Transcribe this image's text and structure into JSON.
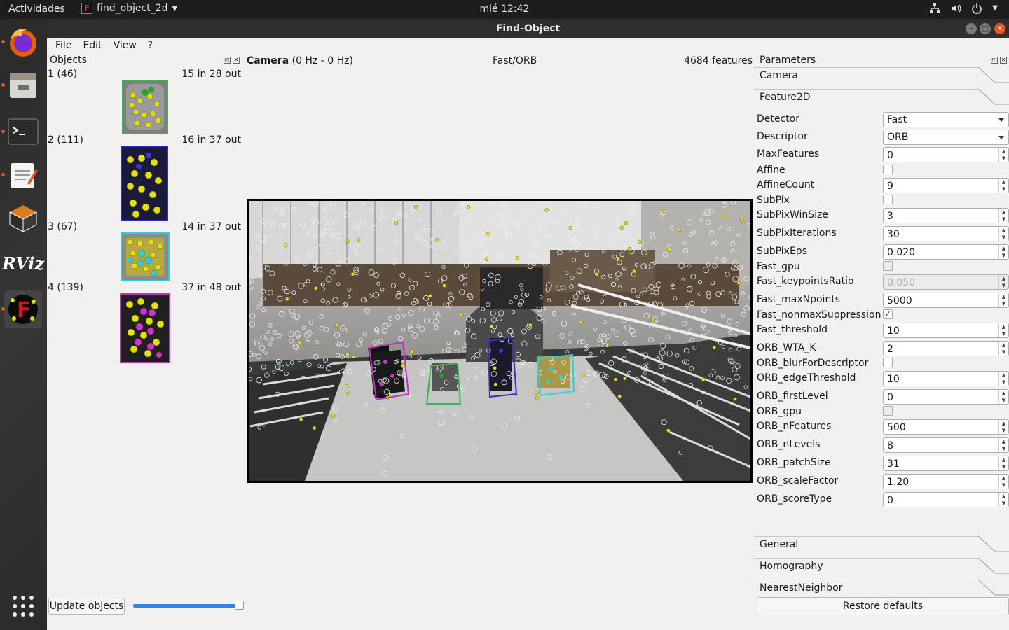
{
  "topbar": {
    "activities": "Actividades",
    "app_name": "find_object_2d",
    "clock": "mié 12:42"
  },
  "window": {
    "title": "Find-Object"
  },
  "menu": [
    "File",
    "Edit",
    "View",
    "?"
  ],
  "objects_panel": {
    "title": "Objects",
    "items": [
      {
        "label": "1 (46)",
        "count": "15 in 28 out",
        "color": "#3cb44b"
      },
      {
        "label": "2 (111)",
        "count": "16 in 37 out",
        "color": "#3030c0"
      },
      {
        "label": "3 (67)",
        "count": "14 in 37 out",
        "color": "#30d0d0"
      },
      {
        "label": "4 (139)",
        "count": "37 in 48 out",
        "color": "#c030c0"
      }
    ],
    "update_button": "Update objects"
  },
  "camera": {
    "title": "Camera",
    "rate": "(0 Hz - 0 Hz)",
    "method": "Fast/ORB",
    "features": "4684 features"
  },
  "parameters": {
    "title": "Parameters",
    "sections_top": [
      "Camera",
      "Feature2D"
    ],
    "rows": [
      {
        "name": "Detector",
        "type": "combo",
        "value": "Fast"
      },
      {
        "name": "Descriptor",
        "type": "combo",
        "value": "ORB"
      },
      {
        "name": "MaxFeatures",
        "type": "spin",
        "value": "0"
      },
      {
        "name": "Affine",
        "type": "check",
        "value": ""
      },
      {
        "name": "AffineCount",
        "type": "spin",
        "value": "9"
      },
      {
        "name": "SubPix",
        "type": "check",
        "value": ""
      },
      {
        "name": "SubPixWinSize",
        "type": "spin",
        "value": "3"
      },
      {
        "name": "SubPixIterations",
        "type": "spin",
        "value": "30"
      },
      {
        "name": "SubPixEps",
        "type": "spin",
        "value": "0.020"
      },
      {
        "name": "Fast_gpu",
        "type": "checkdis",
        "value": ""
      },
      {
        "name": "Fast_keypointsRatio",
        "type": "spindis",
        "value": "0.050"
      },
      {
        "name": "Fast_maxNpoints",
        "type": "spin",
        "value": "5000"
      },
      {
        "name": "Fast_nonmaxSuppression",
        "type": "check",
        "value": "✓"
      },
      {
        "name": "Fast_threshold",
        "type": "spin",
        "value": "10"
      },
      {
        "name": "ORB_WTA_K",
        "type": "spin",
        "value": "2"
      },
      {
        "name": "ORB_blurForDescriptor",
        "type": "check",
        "value": ""
      },
      {
        "name": "ORB_edgeThreshold",
        "type": "spin",
        "value": "10"
      },
      {
        "name": "ORB_firstLevel",
        "type": "spin",
        "value": "0"
      },
      {
        "name": "ORB_gpu",
        "type": "checkdis",
        "value": ""
      },
      {
        "name": "ORB_nFeatures",
        "type": "spin",
        "value": "500"
      },
      {
        "name": "ORB_nLevels",
        "type": "spin",
        "value": "8"
      },
      {
        "name": "ORB_patchSize",
        "type": "spin",
        "value": "31"
      },
      {
        "name": "ORB_scaleFactor",
        "type": "spin",
        "value": "1.20"
      },
      {
        "name": "ORB_scoreType",
        "type": "spin",
        "value": "0"
      }
    ],
    "sections_bottom": [
      "General",
      "Homography",
      "NearestNeighbor"
    ],
    "restore_button": "Restore defaults"
  },
  "dock_icons": [
    "firefox-icon",
    "files-icon",
    "terminal-icon",
    "text-editor-icon",
    "virtualbox-icon",
    "rviz-icon",
    "find-object-icon",
    "app-grid-icon"
  ]
}
